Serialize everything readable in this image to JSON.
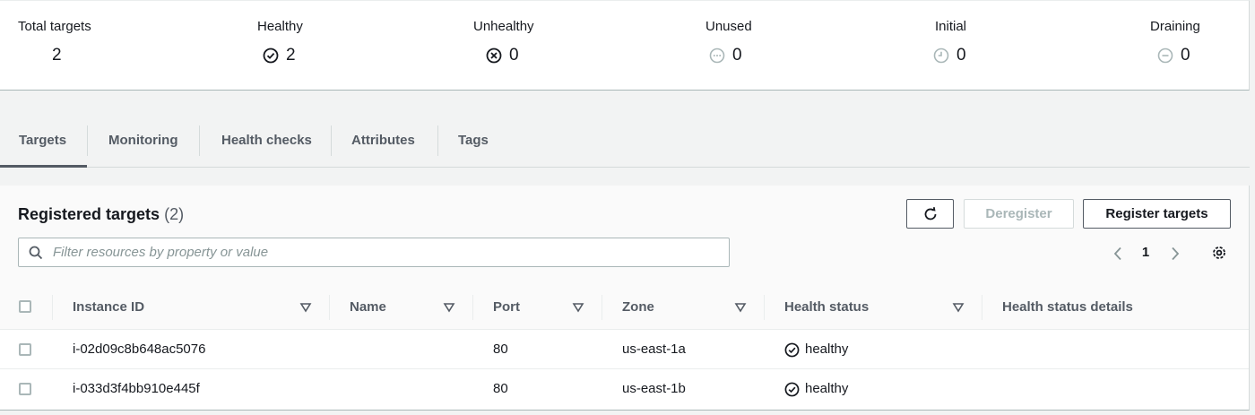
{
  "summary": {
    "total": {
      "label": "Total targets",
      "value": "2"
    },
    "healthy": {
      "label": "Healthy",
      "value": "2",
      "icon": "check-circle-icon"
    },
    "unhealthy": {
      "label": "Unhealthy",
      "value": "0",
      "icon": "x-circle-icon"
    },
    "unused": {
      "label": "Unused",
      "value": "0",
      "icon": "ellipsis-circle-icon"
    },
    "initial": {
      "label": "Initial",
      "value": "0",
      "icon": "clock-icon"
    },
    "draining": {
      "label": "Draining",
      "value": "0",
      "icon": "minus-circle-icon"
    }
  },
  "tabs": [
    {
      "label": "Targets",
      "active": true
    },
    {
      "label": "Monitoring",
      "active": false
    },
    {
      "label": "Health checks",
      "active": false
    },
    {
      "label": "Attributes",
      "active": false
    },
    {
      "label": "Tags",
      "active": false
    }
  ],
  "registered": {
    "title": "Registered targets",
    "count": "(2)",
    "refresh_icon": "refresh-icon",
    "deregister_label": "Deregister",
    "register_label": "Register targets",
    "search_placeholder": "Filter resources by property or value",
    "search_value": "",
    "page": "1"
  },
  "table": {
    "columns": [
      "Instance ID",
      "Name",
      "Port",
      "Zone",
      "Health status",
      "Health status details"
    ],
    "rows": [
      {
        "instance_id": "i-02d09c8b648ac5076",
        "name": "",
        "port": "80",
        "zone": "us-east-1a",
        "health": "healthy",
        "details": ""
      },
      {
        "instance_id": "i-033d3f4bb910e445f",
        "name": "",
        "port": "80",
        "zone": "us-east-1b",
        "health": "healthy",
        "details": ""
      }
    ]
  },
  "colors": {
    "text": "#16191f",
    "secondary_text": "#545b64",
    "border": "#aab7b8",
    "disabled": "#aab7b8",
    "page_bg": "#f2f3f3"
  }
}
